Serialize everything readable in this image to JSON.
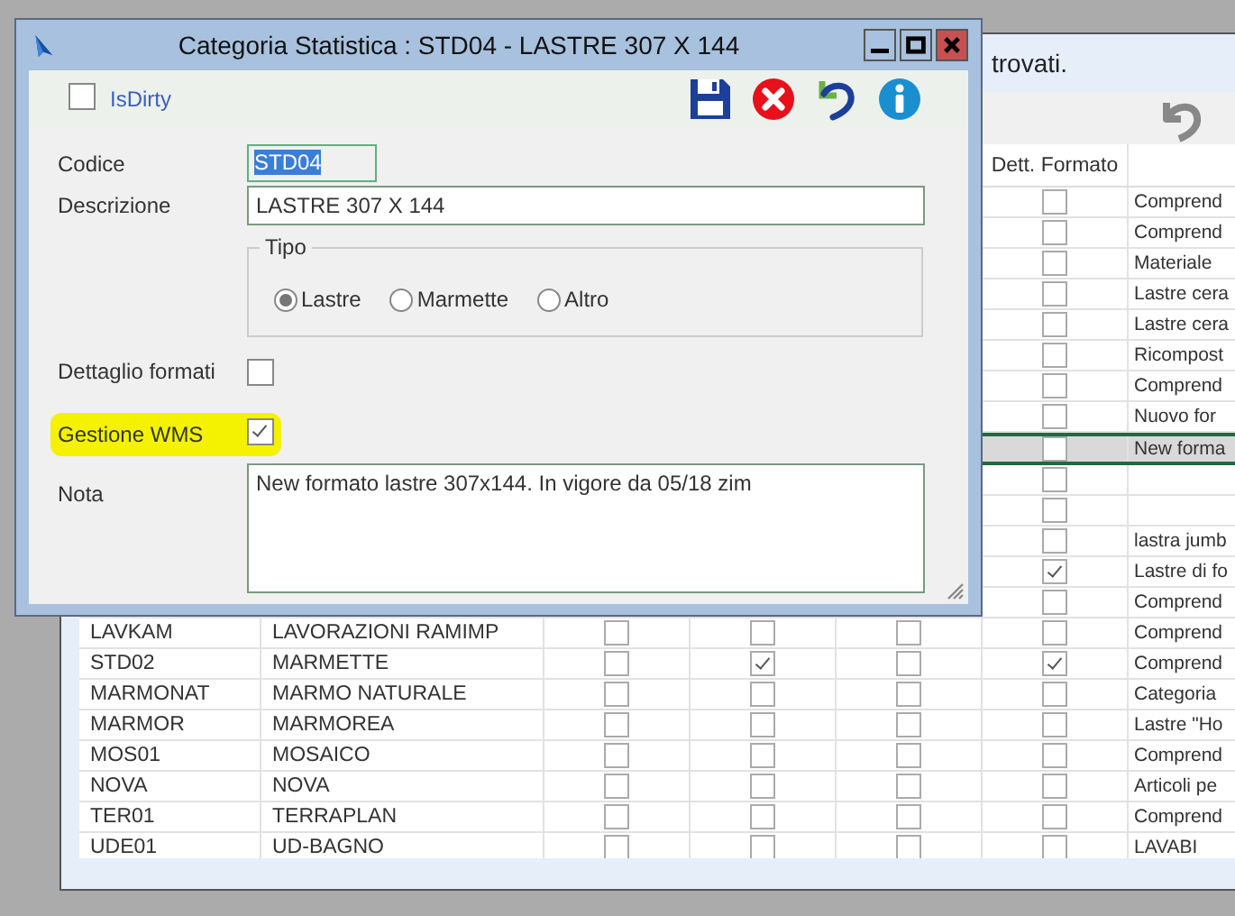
{
  "background_window": {
    "status_text": "trovati.",
    "table": {
      "header": "Dett. Formato",
      "rows": [
        {
          "flag_4": false,
          "note": "Comprend",
          "selected": false
        },
        {
          "flag_4": false,
          "note": "Comprend",
          "selected": false
        },
        {
          "flag_4": false,
          "note": "Materiale",
          "selected": false
        },
        {
          "flag_4": false,
          "note": "Lastre cera",
          "selected": false
        },
        {
          "flag_4": false,
          "note": "Lastre cera",
          "selected": false
        },
        {
          "flag_4": false,
          "note": "Ricompost",
          "selected": false
        },
        {
          "flag_4": false,
          "note": "Comprend",
          "selected": false
        },
        {
          "flag_4": false,
          "note": "Nuovo for",
          "selected": false
        },
        {
          "flag_4": false,
          "note": "New forma",
          "selected": true
        },
        {
          "flag_4": false,
          "selected": false
        },
        {
          "flag_4": false,
          "selected": false
        },
        {
          "flag_4": false,
          "note": "lastra jumb",
          "selected": false
        },
        {
          "flag_4": true,
          "note": "Lastre di fo",
          "selected": false
        },
        {
          "flag_4": false,
          "note": "Comprend",
          "selected": false
        },
        {
          "code": "LAVKAM",
          "description": "LAVORAZIONI RAMIMP",
          "flag_1": false,
          "flag_2": false,
          "flag_3": false,
          "flag_4": false,
          "note": "Comprend",
          "selected": false
        },
        {
          "code": "STD02",
          "description": "MARMETTE",
          "flag_1": false,
          "flag_2": true,
          "flag_3": false,
          "flag_4": true,
          "note": "Comprend",
          "selected": false
        },
        {
          "code": "MARMONAT",
          "description": "MARMO NATURALE",
          "flag_1": false,
          "flag_2": false,
          "flag_3": false,
          "flag_4": false,
          "note": "Categoria",
          "selected": false
        },
        {
          "code": "MARMOR",
          "description": "MARMOREA",
          "flag_1": false,
          "flag_2": false,
          "flag_3": false,
          "flag_4": false,
          "note": "Lastre \"Ho",
          "selected": false
        },
        {
          "code": "MOS01",
          "description": "MOSAICO",
          "flag_1": false,
          "flag_2": false,
          "flag_3": false,
          "flag_4": false,
          "note": "Comprend",
          "selected": false
        },
        {
          "code": "NOVA",
          "description": "NOVA",
          "flag_1": false,
          "flag_2": false,
          "flag_3": false,
          "flag_4": false,
          "note": "Articoli pe",
          "selected": false
        },
        {
          "code": "TER01",
          "description": "TERRAPLAN",
          "flag_1": false,
          "flag_2": false,
          "flag_3": false,
          "flag_4": false,
          "note": "Comprend",
          "selected": false
        },
        {
          "code": "UDE01",
          "description": "UD-BAGNO",
          "flag_1": false,
          "flag_2": false,
          "flag_3": false,
          "flag_4": false,
          "note": "LAVABI",
          "selected": false
        }
      ]
    }
  },
  "dialog": {
    "title": "Categoria Statistica : STD04 - LASTRE 307 X 144",
    "is_dirty": {
      "label": "IsDirty",
      "checked": false
    },
    "codice": {
      "label": "Codice",
      "value": "STD04",
      "text_selected": true
    },
    "descrizione": {
      "label": "Descrizione",
      "value": "LASTRE 307 X 144"
    },
    "tipo": {
      "label": "Tipo",
      "options": [
        {
          "label": "Lastre",
          "selected": true
        },
        {
          "label": "Marmette",
          "selected": false
        },
        {
          "label": "Altro",
          "selected": false
        }
      ]
    },
    "dettaglio_formati": {
      "label": "Dettaglio formati",
      "checked": false
    },
    "gestione_wms": {
      "label": "Gestione WMS",
      "checked": true,
      "highlighted": true
    },
    "nota": {
      "label": "Nota",
      "value": "New formato lastre 307x144. In vigore da 05/18 zim"
    }
  }
}
